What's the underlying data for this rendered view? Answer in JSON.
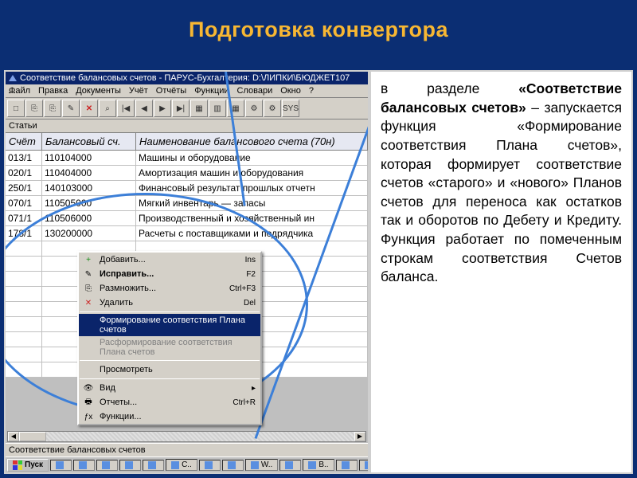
{
  "slide": {
    "title": "Подготовка конвертора"
  },
  "window": {
    "title": "Соответствие балансовых счетов - ПАРУС-Бухгалтерия: D:\\ЛИПКИ\\БЮДЖЕТ107",
    "menu": [
      "Файл",
      "Правка",
      "Документы",
      "Учёт",
      "Отчёты",
      "Функции",
      "Словари",
      "Окно",
      "?"
    ],
    "section": "Статьи",
    "columns": {
      "c1": "Счёт",
      "c2": "Балансовый сч.",
      "c3": "Наименование балансового счета (70н)"
    },
    "rows": [
      {
        "c1": "013/1",
        "c2": "110104000",
        "c3": "Машины и оборудование"
      },
      {
        "c1": "020/1",
        "c2": "110404000",
        "c3": "Амортизация машин и оборудования"
      },
      {
        "c1": "250/1",
        "c2": "140103000",
        "c3": "Финансовый результат прошлых отчетн"
      },
      {
        "c1": "070/1",
        "c2": "110505000",
        "c3": "Мягкий инвентарь — запасы"
      },
      {
        "c1": "071/1",
        "c2": "110506000",
        "c3": "Производственный и хозяйственный ин"
      },
      {
        "c1": "178/1",
        "c2": "130200000",
        "c3": "Расчеты с поставщиками и подрядчика"
      }
    ],
    "status": "Соответствие балансовых счетов"
  },
  "context_menu": {
    "items": [
      {
        "icon": "+",
        "label": "Добавить...",
        "shortcut": "Ins",
        "kind": "normal",
        "iconColor": "#1a8f1a"
      },
      {
        "icon": "✎",
        "label": "Исправить...",
        "shortcut": "F2",
        "kind": "normal",
        "bold": true
      },
      {
        "icon": "⎘",
        "label": "Размножить...",
        "shortcut": "Ctrl+F3",
        "kind": "normal"
      },
      {
        "icon": "✕",
        "label": "Удалить",
        "shortcut": "Del",
        "kind": "normal",
        "iconColor": "#cc2222"
      },
      {
        "kind": "sep"
      },
      {
        "icon": "",
        "label": "Формирование соответствия Плана счетов",
        "shortcut": "",
        "kind": "highlight"
      },
      {
        "icon": "",
        "label": "Расформирование соответствия Плана счетов",
        "shortcut": "",
        "kind": "disabled"
      },
      {
        "kind": "sep"
      },
      {
        "icon": "",
        "label": "Просмотреть",
        "shortcut": "",
        "kind": "normal"
      },
      {
        "kind": "sep"
      },
      {
        "icon": "👁",
        "label": "Вид",
        "shortcut": "▸",
        "kind": "normal"
      },
      {
        "icon": "🖶",
        "label": "Отчеты...",
        "shortcut": "Ctrl+R",
        "kind": "normal"
      },
      {
        "icon": "ƒx",
        "label": "Функции...",
        "shortcut": "",
        "kind": "normal"
      }
    ]
  },
  "toolbar_icons": [
    "□",
    "⎘",
    "⎘",
    "✎",
    "✕",
    "⌕",
    "|◀",
    "◀",
    "▶",
    "▶|",
    "▦",
    "▥",
    "▦",
    "⚙",
    "⚙",
    "SYS"
  ],
  "taskbar": {
    "start": "Пуск",
    "items": [
      "",
      "",
      "",
      "",
      "",
      "C..",
      "",
      "",
      "W..",
      "",
      "B..",
      "",
      "",
      "",
      ""
    ]
  },
  "description": {
    "parts": [
      {
        "t": "в разделе ",
        "b": false
      },
      {
        "t": "«Соответствие балансовых счетов»",
        "b": true
      },
      {
        "t": " – запускается функция «Формирование соответствия Плана счетов», которая формирует соответствие счетов «старого» и «нового» Планов счетов для переноса как остатков так и оборотов по Дебету и Кредиту. Функция работает по помеченным строкам соответствия Счетов баланса.",
        "b": false
      }
    ]
  }
}
